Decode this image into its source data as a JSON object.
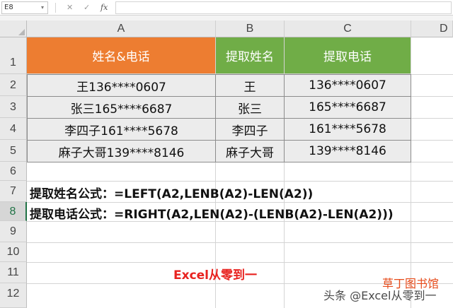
{
  "formula_bar": {
    "name_box": "E8",
    "cancel_glyph": "✕",
    "enter_glyph": "✓",
    "fx_label": "fx",
    "formula_value": ""
  },
  "columns": [
    "A",
    "B",
    "C",
    "D"
  ],
  "rows": [
    "1",
    "2",
    "3",
    "4",
    "5",
    "6",
    "7",
    "8",
    "9",
    "10",
    "11",
    "12"
  ],
  "selected_row": "8",
  "table": {
    "headers": [
      "姓名&电话",
      "提取姓名",
      "提取电话"
    ],
    "header_colors": [
      "#ed7d31",
      "#70ad47",
      "#70ad47"
    ],
    "data": [
      [
        "王136****0607",
        "王",
        "136****0607"
      ],
      [
        "张三165****6687",
        "张三",
        "165****6687"
      ],
      [
        "李四子161****5678",
        "李四子",
        "161****5678"
      ],
      [
        "麻子大哥139****8146",
        "麻子大哥",
        "139****8146"
      ]
    ]
  },
  "formulas": {
    "name_formula": "提取姓名公式：=LEFT(A2,LENB(A2)-LEN(A2))",
    "phone_formula": "提取电话公式：=RIGHT(A2,LEN(A2)-(LENB(A2)-LEN(A2)))"
  },
  "watermarks": {
    "title": "Excel从零到一",
    "stamp": "草丁图书馆",
    "bottom": "头条 @Excel从零到一"
  }
}
